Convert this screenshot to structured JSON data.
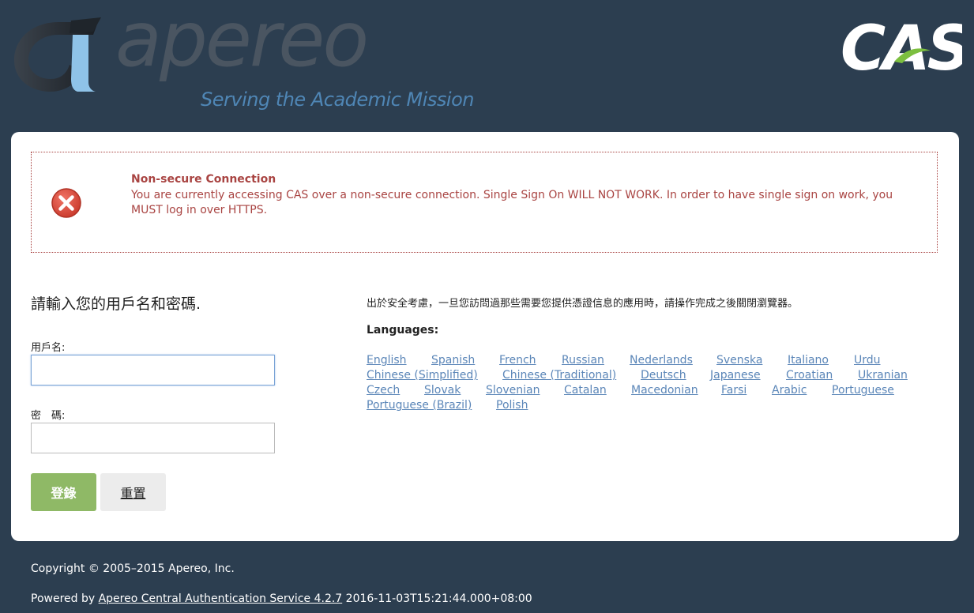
{
  "header": {
    "apereo_word": "apereo",
    "apereo_tagline": "Serving the Academic Mission",
    "cas_logo_text": "CAS"
  },
  "alert": {
    "title": "Non-secure Connection",
    "message": "You are currently accessing CAS over a non-secure connection. Single Sign On WILL NOT WORK. In order to have single sign on work, you MUST log in over HTTPS.",
    "icon": "error-x-icon",
    "color": "#a94442"
  },
  "login": {
    "heading": "請輸入您的用戶名和密碼.",
    "username_label": "用戶名:",
    "username_value": "",
    "password_label": "密　碼:",
    "password_value": "",
    "submit_label": "登錄",
    "reset_label": "重置",
    "submit_color": "#8fb966"
  },
  "sidebar": {
    "security_note": "出於安全考慮，一旦您訪問過那些需要您提供憑證信息的應用時，請操作完成之後關閉瀏覽器。",
    "languages_heading": "Languages:",
    "languages": [
      "English",
      "Spanish",
      "French",
      "Russian",
      "Nederlands",
      "Svenska",
      "Italiano",
      "Urdu",
      "Chinese (Simplified)",
      "Chinese (Traditional)",
      "Deutsch",
      "Japanese",
      "Croatian",
      "Ukranian",
      "Czech",
      "Slovak",
      "Slovenian",
      "Catalan",
      "Macedonian",
      "Farsi",
      "Arabic",
      "Portuguese",
      "Portuguese (Brazil)",
      "Polish"
    ]
  },
  "footer": {
    "copyright": "Copyright © 2005–2015 Apereo, Inc.",
    "powered_prefix": "Powered by ",
    "powered_link": "Apereo Central Authentication Service 4.2.7",
    "build_timestamp": " 2016-11-03T15:21:44.000+08:00"
  },
  "colors": {
    "background": "#2c3e50",
    "link": "#5b86b8"
  }
}
